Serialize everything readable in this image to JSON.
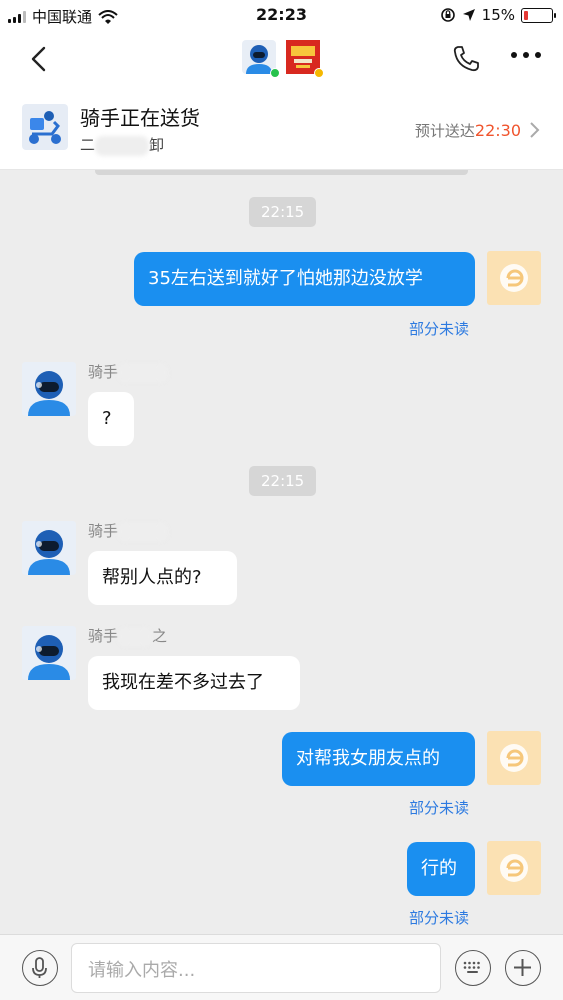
{
  "status_bar": {
    "carrier": "中国联通",
    "time": "22:23",
    "battery_text": "15%",
    "battery_level": 0.15
  },
  "delivery": {
    "title": "骑手正在送货",
    "subtitle_prefix": "二",
    "subtitle_suffix": "卸",
    "eta_label": "预计送达",
    "eta_time": "22:30"
  },
  "messages": [
    {
      "kind": "timestamp",
      "text": "22:15"
    },
    {
      "kind": "outgoing",
      "text": "35左右送到就好了怕她那边没放学",
      "status": "部分未读"
    },
    {
      "kind": "incoming",
      "sender": "骑手",
      "text": "?"
    },
    {
      "kind": "timestamp",
      "text": "22:15"
    },
    {
      "kind": "incoming",
      "sender": "骑手",
      "text": "帮别人点的?"
    },
    {
      "kind": "incoming",
      "sender": "骑手",
      "sender_suffix": "之",
      "text": "我现在差不多过去了"
    },
    {
      "kind": "outgoing",
      "text": "对帮我女朋友点的",
      "status": "部分未读"
    },
    {
      "kind": "outgoing",
      "text": "行的",
      "status": "部分未读"
    }
  ],
  "input": {
    "placeholder": "请输入内容..."
  },
  "colors": {
    "accent_blue": "#1a8ff0",
    "eta_orange": "#f0542d",
    "online_green": "#27c24c"
  }
}
